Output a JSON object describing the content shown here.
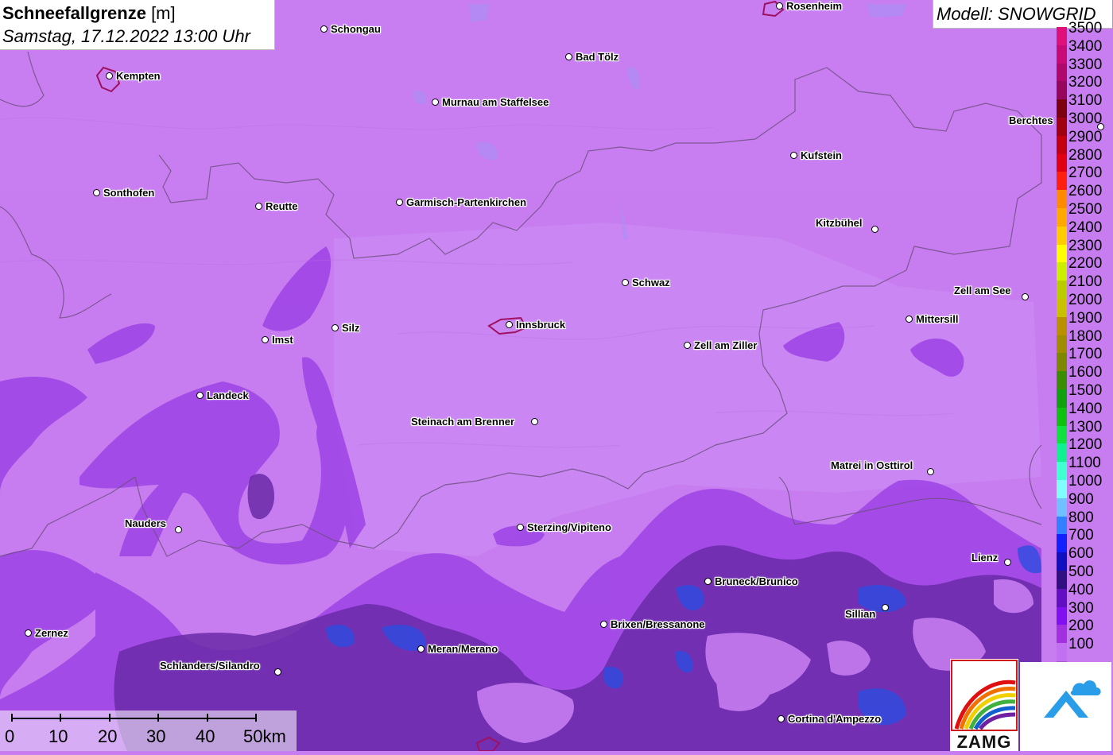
{
  "title": {
    "main_bold": "Schneefallgrenze",
    "main_unit": " [m]",
    "datetime": "Samstag, 17.12.2022 13:00 Uhr"
  },
  "model": {
    "label": "Modell: SNOWGRID"
  },
  "legend": {
    "items": [
      {
        "value": "3500",
        "color": "#e0107a"
      },
      {
        "value": "3400",
        "color": "#c80a74"
      },
      {
        "value": "3300",
        "color": "#b0086a"
      },
      {
        "value": "3200",
        "color": "#96065c"
      },
      {
        "value": "3100",
        "color": "#7c0210"
      },
      {
        "value": "3000",
        "color": "#a00010"
      },
      {
        "value": "2900",
        "color": "#c40010"
      },
      {
        "value": "2800",
        "color": "#e00010"
      },
      {
        "value": "2700",
        "color": "#ff2010"
      },
      {
        "value": "2600",
        "color": "#ff8c00"
      },
      {
        "value": "2500",
        "color": "#ffa800"
      },
      {
        "value": "2400",
        "color": "#ffcc00"
      },
      {
        "value": "2300",
        "color": "#ffff00"
      },
      {
        "value": "2200",
        "color": "#ccee00"
      },
      {
        "value": "2100",
        "color": "#b8cc00"
      },
      {
        "value": "2000",
        "color": "#c8c000"
      },
      {
        "value": "1900",
        "color": "#b89000"
      },
      {
        "value": "1800",
        "color": "#a08c00"
      },
      {
        "value": "1700",
        "color": "#7c8800"
      },
      {
        "value": "1600",
        "color": "#3c8c00"
      },
      {
        "value": "1500",
        "color": "#10a010"
      },
      {
        "value": "1400",
        "color": "#10c010"
      },
      {
        "value": "1300",
        "color": "#10e040"
      },
      {
        "value": "1200",
        "color": "#10f090"
      },
      {
        "value": "1100",
        "color": "#40ffd0"
      },
      {
        "value": "1000",
        "color": "#80ffff"
      },
      {
        "value": "900",
        "color": "#70c0ff"
      },
      {
        "value": "800",
        "color": "#3080ff"
      },
      {
        "value": "700",
        "color": "#1020ff"
      },
      {
        "value": "600",
        "color": "#1010c0"
      },
      {
        "value": "500",
        "color": "#301080"
      },
      {
        "value": "400",
        "color": "#6010c0"
      },
      {
        "value": "300",
        "color": "#8010f0"
      },
      {
        "value": "200",
        "color": "#a030e0"
      },
      {
        "value": "100",
        "color": "#c070f0"
      }
    ]
  },
  "cities": [
    {
      "name": "Rosenheim"
    },
    {
      "name": "Schongau"
    },
    {
      "name": "Bad Tölz"
    },
    {
      "name": "Kempten"
    },
    {
      "name": "Murnau am Staffelsee"
    },
    {
      "name": "Berchtes"
    },
    {
      "name": "Kufstein"
    },
    {
      "name": "Sonthofen"
    },
    {
      "name": "Reutte"
    },
    {
      "name": "Garmisch-Partenkirchen"
    },
    {
      "name": "Kitzbühel"
    },
    {
      "name": "Schwaz"
    },
    {
      "name": "Zell am See"
    },
    {
      "name": "Silz"
    },
    {
      "name": "Imst"
    },
    {
      "name": "Innsbruck"
    },
    {
      "name": "Mittersill"
    },
    {
      "name": "Zell am Ziller"
    },
    {
      "name": "Landeck"
    },
    {
      "name": "Steinach am Brenner"
    },
    {
      "name": "Matrei in Osttirol"
    },
    {
      "name": "Nauders"
    },
    {
      "name": "Sterzing/Vipiteno"
    },
    {
      "name": "Lienz"
    },
    {
      "name": "Bruneck/Brunico"
    },
    {
      "name": "Sillian"
    },
    {
      "name": "Brixen/Bressanone"
    },
    {
      "name": "Zernez"
    },
    {
      "name": "Meran/Merano"
    },
    {
      "name": "Schlanders/Silandro"
    },
    {
      "name": "Cortina d'Ampezzo"
    }
  ],
  "scalebar": {
    "labels": [
      "0",
      "10",
      "20",
      "30",
      "40",
      "50km"
    ]
  },
  "logos": {
    "zamg": "ZAMG"
  }
}
